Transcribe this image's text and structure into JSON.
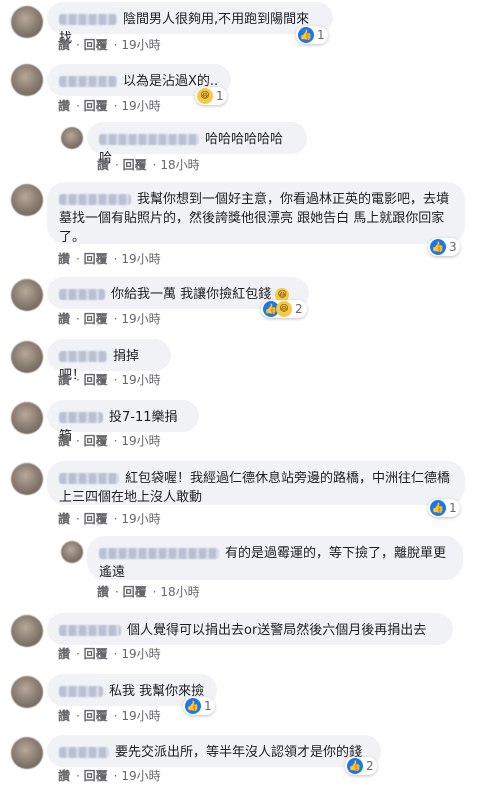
{
  "actions": {
    "like": "讚",
    "reply": "回覆"
  },
  "comments": [
    {
      "text": "陰間男人很夠用,不用跑到陽間來找",
      "time": "19小時",
      "reaction_count": "1"
    },
    {
      "text": "以為是沾過X的..",
      "time": "19小時",
      "reaction_count": "1"
    },
    {
      "text": "哈哈哈哈哈哈哈",
      "time": "18小時"
    },
    {
      "text": "我幫你想到一個好主意，你看過林正英的電影吧，去墳墓找一個有貼照片的，然後誇獎他很漂亮 跟她告白 馬上就跟你回家了。",
      "time": "19小時",
      "reaction_count": "3"
    },
    {
      "text": "你給我一萬 我讓你撿紅包錢",
      "time": "19小時",
      "reaction_count": "2"
    },
    {
      "text": "捐掉吧！",
      "time": "19小時"
    },
    {
      "text": "投7-11樂捐箱",
      "time": "19小時"
    },
    {
      "text": "紅包袋喔！我經過仁德休息站旁邊的路橋，中洲往仁德橋上三四個在地上沒人敢動",
      "time": "19小時",
      "reaction_count": "1"
    },
    {
      "text": "有的是過霉運的，等下撿了，離脫單更遙遠",
      "time": "18小時"
    },
    {
      "text": "個人覺得可以捐出去or送警局然後六個月後再捐出去",
      "time": "19小時"
    },
    {
      "text": "私我 我幫你來撿",
      "time": "19小時",
      "reaction_count": "1"
    },
    {
      "text": "要先交派出所，等半年沒人認領才是你的錢",
      "time": "19小時",
      "reaction_count": "2"
    }
  ]
}
